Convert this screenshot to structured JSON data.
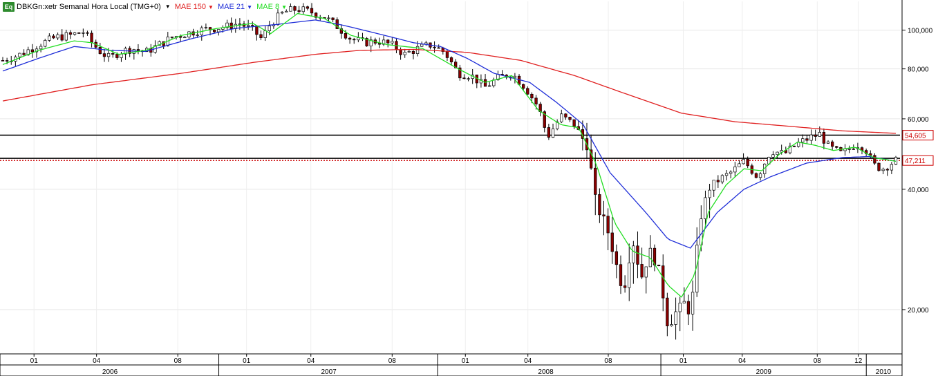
{
  "header": {
    "icon": "Eq",
    "symbol": "DBKGn:xetr Semanal Hora Local (TMG+0)",
    "ma1": {
      "label": "MAE 150",
      "color": "#e02020"
    },
    "ma2": {
      "label": "MAE 21",
      "color": "#1f2ed8"
    },
    "ma3": {
      "label": "MAE 8",
      "color": "#22dd22"
    }
  },
  "chart_data": {
    "type": "candlestick",
    "scale": "log",
    "ylim": [
      15500,
      118000
    ],
    "y_ticks": [
      {
        "value": 100000,
        "label": "100,000"
      },
      {
        "value": 80000,
        "label": "80,000"
      },
      {
        "value": 60000,
        "label": "60,000"
      },
      {
        "value": 40000,
        "label": "40,000"
      },
      {
        "value": 20000,
        "label": "20,000"
      }
    ],
    "x_month_ticks": [
      {
        "label": "01",
        "t": 0.035
      },
      {
        "label": "04",
        "t": 0.105
      },
      {
        "label": "08",
        "t": 0.196
      },
      {
        "label": "01",
        "t": 0.273
      },
      {
        "label": "04",
        "t": 0.345
      },
      {
        "label": "08",
        "t": 0.436
      },
      {
        "label": "01",
        "t": 0.518
      },
      {
        "label": "04",
        "t": 0.588
      },
      {
        "label": "08",
        "t": 0.678
      },
      {
        "label": "01",
        "t": 0.762
      },
      {
        "label": "04",
        "t": 0.828
      },
      {
        "label": "08",
        "t": 0.912
      },
      {
        "label": "12",
        "t": 0.958
      }
    ],
    "x_year_labels": [
      {
        "label": "2006",
        "t": 0.12
      },
      {
        "label": "2007",
        "t": 0.365
      },
      {
        "label": "2008",
        "t": 0.608
      },
      {
        "label": "2009",
        "t": 0.852
      },
      {
        "label": "2010",
        "t": 0.986
      }
    ],
    "x_year_separators": [
      0.0,
      0.245,
      0.49,
      0.74,
      0.97
    ],
    "horizontal_lines": [
      {
        "value": 54605,
        "label": "54,605",
        "color": "#000000",
        "style": "solid"
      },
      {
        "value": 47800,
        "label": "",
        "color": "#000000",
        "style": "solid"
      },
      {
        "value": 47211,
        "label": "47,211",
        "color": "#cc0000",
        "style": "dotted"
      }
    ],
    "close_anchors": [
      [
        0.0,
        84000
      ],
      [
        0.02,
        87000
      ],
      [
        0.04,
        92000
      ],
      [
        0.06,
        96000
      ],
      [
        0.075,
        97000
      ],
      [
        0.09,
        99000
      ],
      [
        0.1,
        93000
      ],
      [
        0.11,
        88000
      ],
      [
        0.12,
        85000
      ],
      [
        0.13,
        88000
      ],
      [
        0.145,
        90000
      ],
      [
        0.16,
        88000
      ],
      [
        0.175,
        92000
      ],
      [
        0.19,
        96000
      ],
      [
        0.205,
        98000
      ],
      [
        0.22,
        100000
      ],
      [
        0.235,
        101000
      ],
      [
        0.25,
        102000
      ],
      [
        0.265,
        104000
      ],
      [
        0.28,
        100000
      ],
      [
        0.29,
        95000
      ],
      [
        0.3,
        104000
      ],
      [
        0.315,
        111000
      ],
      [
        0.33,
        113000
      ],
      [
        0.345,
        111000
      ],
      [
        0.36,
        108000
      ],
      [
        0.375,
        102000
      ],
      [
        0.39,
        95000
      ],
      [
        0.405,
        93000
      ],
      [
        0.42,
        94000
      ],
      [
        0.435,
        92000
      ],
      [
        0.45,
        87000
      ],
      [
        0.465,
        90000
      ],
      [
        0.48,
        92000
      ],
      [
        0.495,
        88000
      ],
      [
        0.51,
        78000
      ],
      [
        0.525,
        77000
      ],
      [
        0.54,
        72000
      ],
      [
        0.555,
        76000
      ],
      [
        0.57,
        78000
      ],
      [
        0.585,
        72000
      ],
      [
        0.6,
        64000
      ],
      [
        0.61,
        54000
      ],
      [
        0.625,
        61000
      ],
      [
        0.64,
        58000
      ],
      [
        0.655,
        51000
      ],
      [
        0.665,
        36000
      ],
      [
        0.675,
        33000
      ],
      [
        0.685,
        27000
      ],
      [
        0.695,
        22000
      ],
      [
        0.705,
        30000
      ],
      [
        0.715,
        24000
      ],
      [
        0.725,
        28000
      ],
      [
        0.735,
        25000
      ],
      [
        0.745,
        18000
      ],
      [
        0.755,
        20000
      ],
      [
        0.765,
        21000
      ],
      [
        0.77,
        19000
      ],
      [
        0.78,
        33000
      ],
      [
        0.79,
        40000
      ],
      [
        0.8,
        42000
      ],
      [
        0.815,
        44000
      ],
      [
        0.83,
        47000
      ],
      [
        0.845,
        43000
      ],
      [
        0.86,
        50000
      ],
      [
        0.875,
        49000
      ],
      [
        0.89,
        52000
      ],
      [
        0.905,
        54000
      ],
      [
        0.915,
        55000
      ],
      [
        0.925,
        51000
      ],
      [
        0.94,
        49000
      ],
      [
        0.955,
        52000
      ],
      [
        0.965,
        51000
      ],
      [
        0.975,
        46000
      ],
      [
        0.985,
        45000
      ],
      [
        1.0,
        47211
      ]
    ],
    "ma150": [
      [
        0.0,
        66500
      ],
      [
        0.1,
        73000
      ],
      [
        0.2,
        78000
      ],
      [
        0.28,
        83000
      ],
      [
        0.35,
        87000
      ],
      [
        0.4,
        89000
      ],
      [
        0.46,
        89500
      ],
      [
        0.52,
        88000
      ],
      [
        0.58,
        84000
      ],
      [
        0.64,
        77000
      ],
      [
        0.7,
        69000
      ],
      [
        0.76,
        62000
      ],
      [
        0.82,
        59000
      ],
      [
        0.88,
        57500
      ],
      [
        0.94,
        56000
      ],
      [
        1.0,
        55200
      ]
    ],
    "ma21": [
      [
        0.0,
        79000
      ],
      [
        0.04,
        85000
      ],
      [
        0.08,
        91000
      ],
      [
        0.12,
        89000
      ],
      [
        0.16,
        88500
      ],
      [
        0.21,
        95000
      ],
      [
        0.26,
        101000
      ],
      [
        0.31,
        103500
      ],
      [
        0.35,
        106000
      ],
      [
        0.38,
        103000
      ],
      [
        0.42,
        98000
      ],
      [
        0.46,
        93000
      ],
      [
        0.49,
        91000
      ],
      [
        0.52,
        85000
      ],
      [
        0.55,
        78000
      ],
      [
        0.59,
        74000
      ],
      [
        0.62,
        66000
      ],
      [
        0.65,
        58000
      ],
      [
        0.68,
        44000
      ],
      [
        0.72,
        35000
      ],
      [
        0.745,
        30000
      ],
      [
        0.77,
        28500
      ],
      [
        0.8,
        35000
      ],
      [
        0.83,
        40000
      ],
      [
        0.86,
        43000
      ],
      [
        0.9,
        46500
      ],
      [
        0.94,
        48000
      ],
      [
        0.97,
        48300
      ],
      [
        1.0,
        47000
      ]
    ],
    "ma8": [
      [
        0.0,
        82000
      ],
      [
        0.04,
        89000
      ],
      [
        0.08,
        94000
      ],
      [
        0.1,
        93000
      ],
      [
        0.13,
        87000
      ],
      [
        0.16,
        89000
      ],
      [
        0.2,
        97000
      ],
      [
        0.24,
        101000
      ],
      [
        0.28,
        104000
      ],
      [
        0.3,
        98000
      ],
      [
        0.33,
        110000
      ],
      [
        0.36,
        107000
      ],
      [
        0.39,
        97000
      ],
      [
        0.43,
        92000
      ],
      [
        0.47,
        90000
      ],
      [
        0.51,
        80000
      ],
      [
        0.54,
        74000
      ],
      [
        0.57,
        77000
      ],
      [
        0.6,
        63000
      ],
      [
        0.625,
        58000
      ],
      [
        0.645,
        57000
      ],
      [
        0.665,
        46000
      ],
      [
        0.685,
        33000
      ],
      [
        0.705,
        28000
      ],
      [
        0.725,
        27000
      ],
      [
        0.745,
        23000
      ],
      [
        0.76,
        21500
      ],
      [
        0.775,
        24500
      ],
      [
        0.79,
        35000
      ],
      [
        0.81,
        41000
      ],
      [
        0.83,
        45000
      ],
      [
        0.85,
        44500
      ],
      [
        0.87,
        49000
      ],
      [
        0.89,
        52500
      ],
      [
        0.91,
        51500
      ],
      [
        0.93,
        50000
      ],
      [
        0.955,
        51000
      ],
      [
        0.975,
        48000
      ],
      [
        1.0,
        47000
      ]
    ]
  }
}
